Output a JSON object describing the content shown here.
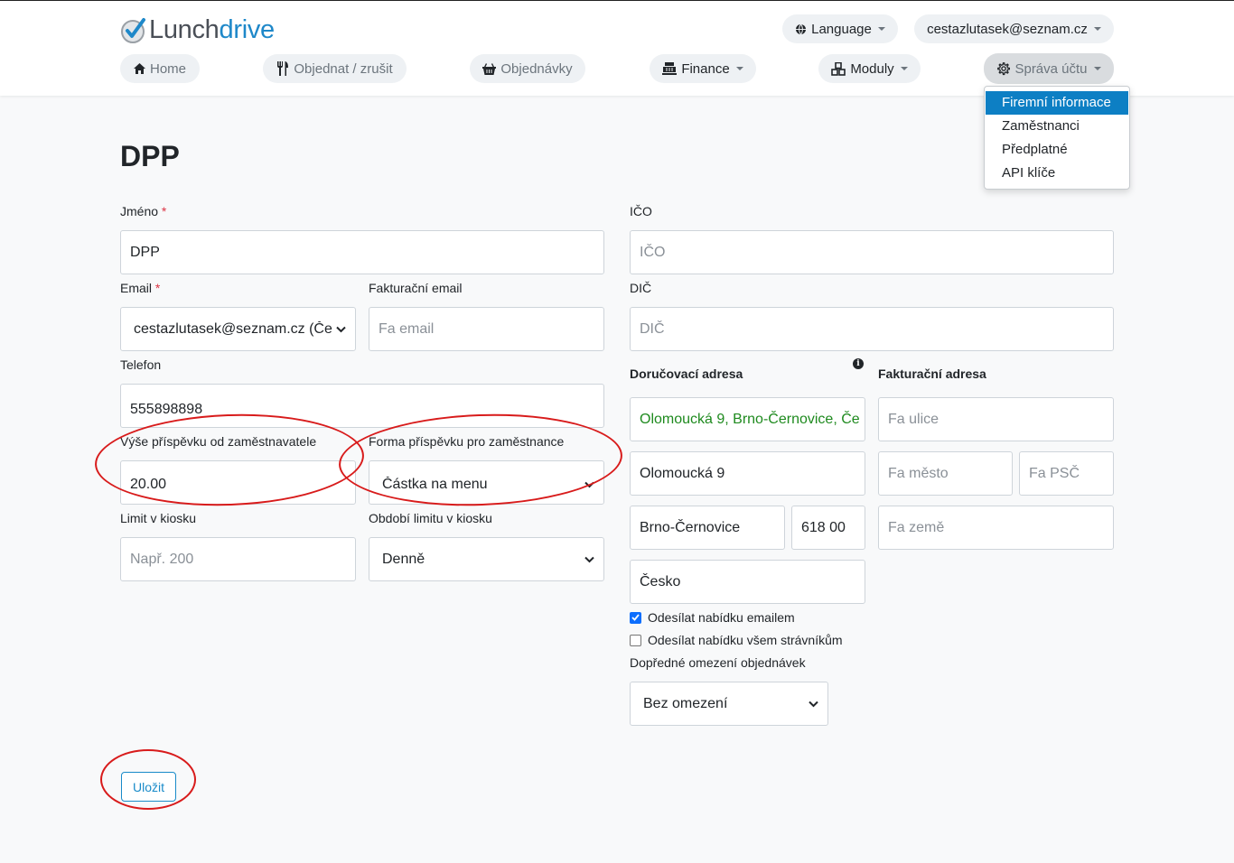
{
  "header": {
    "logo": {
      "part1": "Lunch",
      "part2": "drive"
    },
    "language_label": "Language",
    "user_email": "cestazlutasek@seznam.cz",
    "nav": {
      "home": "Home",
      "order": "Objednat / zrušit",
      "orders": "Objednávky",
      "finance": "Finance",
      "modules": "Moduly",
      "account": "Správa účtu"
    },
    "account_menu": [
      "Firemní informace",
      "Zaměstnanci",
      "Předplatné",
      "API klíče"
    ]
  },
  "page": {
    "title": "DPP"
  },
  "form": {
    "name_label": "Jméno",
    "name_value": "DPP",
    "email_label": "Email",
    "email_value": "cestazlutasek@seznam.cz (Če",
    "invoice_email_label": "Fakturační email",
    "invoice_email_placeholder": "Fa email",
    "phone_label": "Telefon",
    "phone_value": "555898898",
    "contribution_label": "Výše příspěvku od zaměstnavatele",
    "contribution_value": "20.00",
    "contribution_form_label": "Forma příspěvku pro zaměstnance",
    "contribution_form_value": "Částka na menu",
    "kiosk_limit_label": "Limit v kiosku",
    "kiosk_limit_placeholder": "Např. 200",
    "kiosk_period_label": "Období limitu v kiosku",
    "kiosk_period_value": "Denně",
    "ico_label": "IČO",
    "ico_placeholder": "IČO",
    "dic_label": "DIČ",
    "dic_placeholder": "DIČ",
    "delivery": {
      "heading": "Doručovací adresa",
      "search_value": "Olomoucká 9, Brno-Černovice, Če",
      "street": "Olomoucká 9",
      "city": "Brno-Černovice",
      "zip": "618 00",
      "country": "Česko"
    },
    "billing": {
      "heading": "Fakturační adresa",
      "street_placeholder": "Fa ulice",
      "city_placeholder": "Fa město",
      "zip_placeholder": "Fa PSČ",
      "country_placeholder": "Fa země"
    },
    "send_offer_email_label": "Odesílat nabídku emailem",
    "send_offer_email_checked": true,
    "send_offer_all_label": "Odesílat nabídku všem strávníkům",
    "send_offer_all_checked": false,
    "order_limit_label": "Dopředné omezení objednávek",
    "order_limit_value": "Bez omezení",
    "save_label": "Uložit"
  },
  "colors": {
    "accent": "#1e88c9",
    "annotation": "#d81b1b",
    "link_green": "#1e8a1e"
  }
}
